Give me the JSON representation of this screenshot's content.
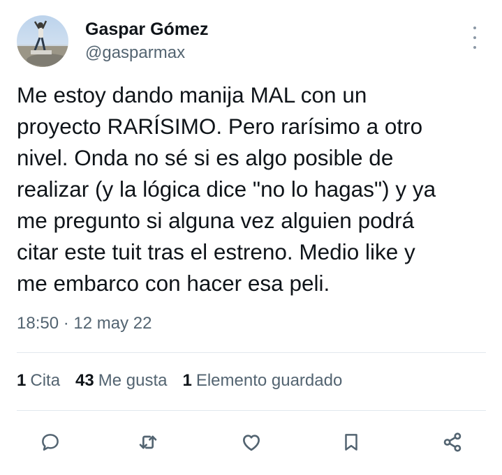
{
  "author": {
    "name": "Gaspar Gómez",
    "handle": "@gasparmax"
  },
  "tweet": {
    "lines": [
      "Me estoy dando manija MAL con un",
      "proyecto RARÍSIMO. Pero rarísimo a otro",
      "nivel. Onda no sé si es algo posible de",
      "realizar (y la lógica dice \"no lo hagas\") y ya",
      "me pregunto si alguna vez alguien podrá",
      "citar este tuit tras el estreno. Medio like y",
      "me embarco con hacer esa peli."
    ],
    "timestamp": "18:50 · 12 may 22"
  },
  "stats": [
    {
      "count": "1",
      "label": "Cita"
    },
    {
      "count": "43",
      "label": "Me gusta"
    },
    {
      "count": "1",
      "label": "Elemento guardado"
    }
  ],
  "actions": [
    {
      "icon": "reply-icon"
    },
    {
      "icon": "retweet-icon"
    },
    {
      "icon": "like-icon"
    },
    {
      "icon": "bookmark-icon"
    },
    {
      "icon": "share-icon"
    }
  ],
  "colors": {
    "text": "#0f1419",
    "secondary": "#536471",
    "divider": "#e1e8ed"
  }
}
